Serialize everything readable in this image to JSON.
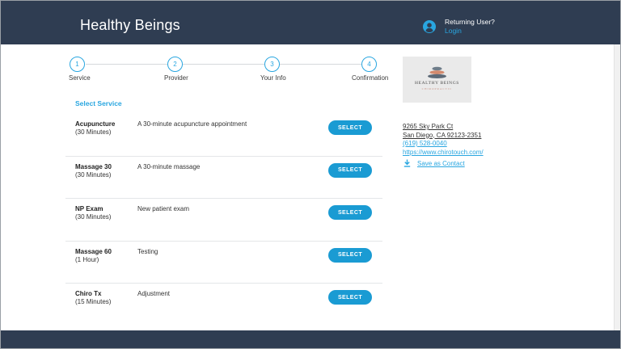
{
  "header": {
    "brand": "Healthy Beings",
    "returning_user": "Returning User?",
    "login": "Login"
  },
  "stepper": {
    "steps": [
      {
        "number": "1",
        "label": "Service"
      },
      {
        "number": "2",
        "label": "Provider"
      },
      {
        "number": "3",
        "label": "Your Info"
      },
      {
        "number": "4",
        "label": "Confirmation"
      }
    ]
  },
  "main": {
    "section_title": "Select Service",
    "services": [
      {
        "name": "Acupuncture",
        "duration": "(30 Minutes)",
        "description": "A 30-minute acupuncture appointment",
        "button": "SELECT"
      },
      {
        "name": "Massage 30",
        "duration": "(30 Minutes)",
        "description": "A 30-minute massage",
        "button": "SELECT"
      },
      {
        "name": "NP Exam",
        "duration": "(30 Minutes)",
        "description": "New patient exam",
        "button": "SELECT"
      },
      {
        "name": "Massage 60",
        "duration": "(1 Hour)",
        "description": "Testing",
        "button": "SELECT"
      },
      {
        "name": "Chiro Tx",
        "duration": "(15 Minutes)",
        "description": "Adjustment",
        "button": "SELECT"
      }
    ]
  },
  "sidebar": {
    "logo_name": "HEALTHY BEINGS",
    "logo_sub": "CHIROPRACTIC",
    "address_line1": "9265 Sky Park Ct",
    "address_line2": "San Diego, CA 92123-2351",
    "phone": "(619) 528-0040",
    "website": "https://www.chirotouch.com/",
    "save_contact": "Save as Contact"
  },
  "colors": {
    "header_bg": "#2f3d52",
    "accent": "#29a6e0",
    "button_bg": "#1a9bd3"
  },
  "icons": {
    "user": "user-circle-icon",
    "save": "download-icon"
  }
}
